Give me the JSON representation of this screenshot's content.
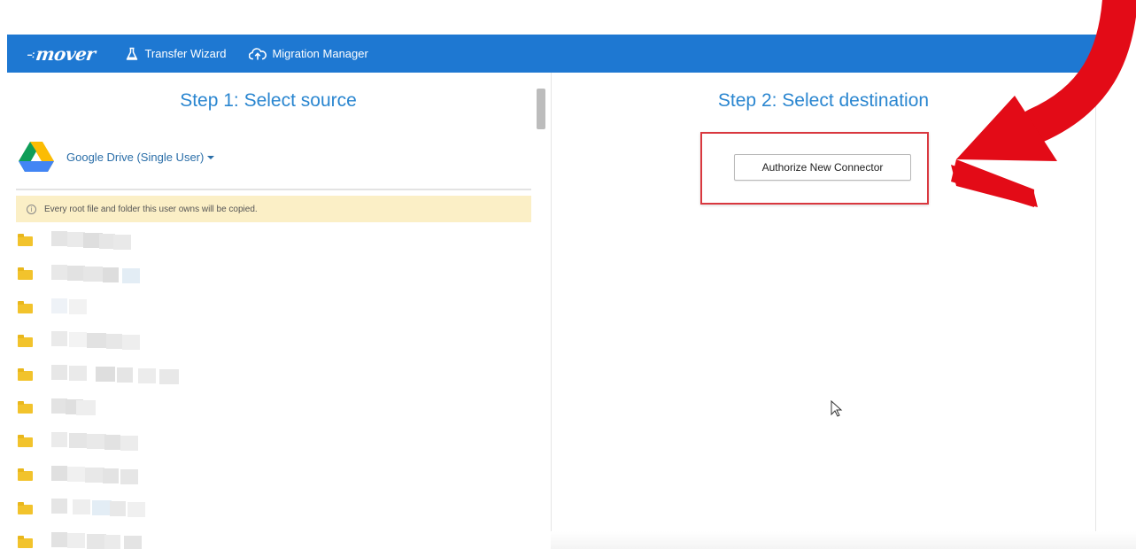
{
  "navbar": {
    "logo": "mover",
    "links": [
      {
        "label": "Transfer Wizard",
        "icon": "flask-icon"
      },
      {
        "label": "Migration Manager",
        "icon": "cloud-upload-icon"
      }
    ],
    "color": "#1e78d2"
  },
  "source": {
    "title": "Step 1: Select source",
    "selector_label": "Google Drive (Single User)",
    "selector_icon": "google-drive-icon",
    "notice": "Every root file and folder this user owns will be copied.",
    "notice_icon": "info-icon",
    "folder_count": 10
  },
  "destination": {
    "title": "Step 2: Select destination",
    "authorize_button": "Authorize New Connector"
  },
  "colors": {
    "title_blue": "#2a86d0",
    "notice_bg": "#fbefc6",
    "folder_yellow": "#f2c32c",
    "highlight_red": "#d9383f",
    "arrow_red": "#e30b17"
  }
}
